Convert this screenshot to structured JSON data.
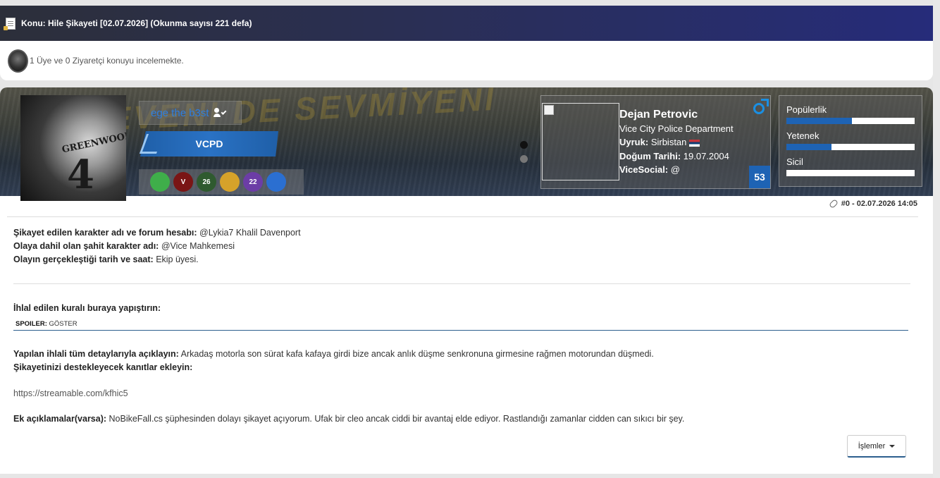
{
  "topic": {
    "title": "Konu: Hile Şikayeti [02.07.2026]  (Okunma sayısı 221 defa)"
  },
  "viewers": {
    "text": "1 Üye ve 0 Ziyaretçi konuyu incelemekte."
  },
  "banner": {
    "bg_text": "SEVENI DE SEVMİYENİ"
  },
  "author": {
    "avatar_name": "GREENWOOD",
    "avatar_number": "4",
    "username": "ege the b3st",
    "group": "VCPD",
    "medals": [
      {
        "icon": "v-medal",
        "label": "",
        "color": "#3fae4a"
      },
      {
        "icon": "shield-medal",
        "label": "V",
        "color": "#7a1515"
      },
      {
        "icon": "26-medal",
        "label": "26",
        "color": "#2f5a2f"
      },
      {
        "icon": "sun-medal",
        "label": "",
        "color": "#d6a22a"
      },
      {
        "icon": "22-medal",
        "label": "22",
        "color": "#6c3da6"
      },
      {
        "icon": "globe-medal",
        "label": "",
        "color": "#2b6fd1"
      }
    ]
  },
  "character": {
    "name": "Dejan Petrovic",
    "department": "Vice City Police Department",
    "nationality_label": "Uyruk:",
    "nationality": "Sirbistan",
    "birth_label": "Doğum Tarihi:",
    "birth": "19.07.2004",
    "social_label": "ViceSocial:",
    "social": "@",
    "level": "53"
  },
  "stats": [
    {
      "label": "Popülerlik",
      "value": 0.51
    },
    {
      "label": "Yetenek",
      "value": 0.35
    },
    {
      "label": "Sicil",
      "value": 0.0
    }
  ],
  "post_meta": "#0 - 02.07.2026 14:05",
  "body": {
    "l1_label": "Şikayet edilen karakter adı ve forum hesabı:",
    "l1_value": "@Lykia7 Khalil Davenport",
    "l2_label": "Olaya dahil olan şahit karakter adı:",
    "l2_value": "@Vice Mahkemesi",
    "l3_label": "Olayın gerçekleştiği tarih ve saat:",
    "l3_value": "Ekip üyesi.",
    "l4_label": "İhlal edilen kuralı buraya yapıştırın:",
    "spoiler_label": "SPOILER:",
    "spoiler_action": "GÖSTER",
    "l5_label": "Yapılan ihlali tüm detaylarıyla açıklayın:",
    "l5_value": "Arkadaş motorla son sürat kafa kafaya girdi bize ancak anlık düşme senkronuna girmesine rağmen motorundan düşmedi.",
    "l6_label": "Şikayetinizi destekleyecek kanıtlar ekleyin:",
    "link": "https://streamable.com/kfhic5",
    "l7_label": "Ek açıklamalar(varsa):",
    "l7_value": "NoBikeFall.cs şüphesinden dolayı şikayet açıyorum. Ufak bir cleo ancak ciddi bir avantaj elde ediyor. Rastlandığı zamanlar cidden can sıkıcı bir şey."
  },
  "actions": {
    "islemler": "İşlemler"
  },
  "colors": {
    "accent": "#1e63b4",
    "username": "#2e7fe0"
  }
}
